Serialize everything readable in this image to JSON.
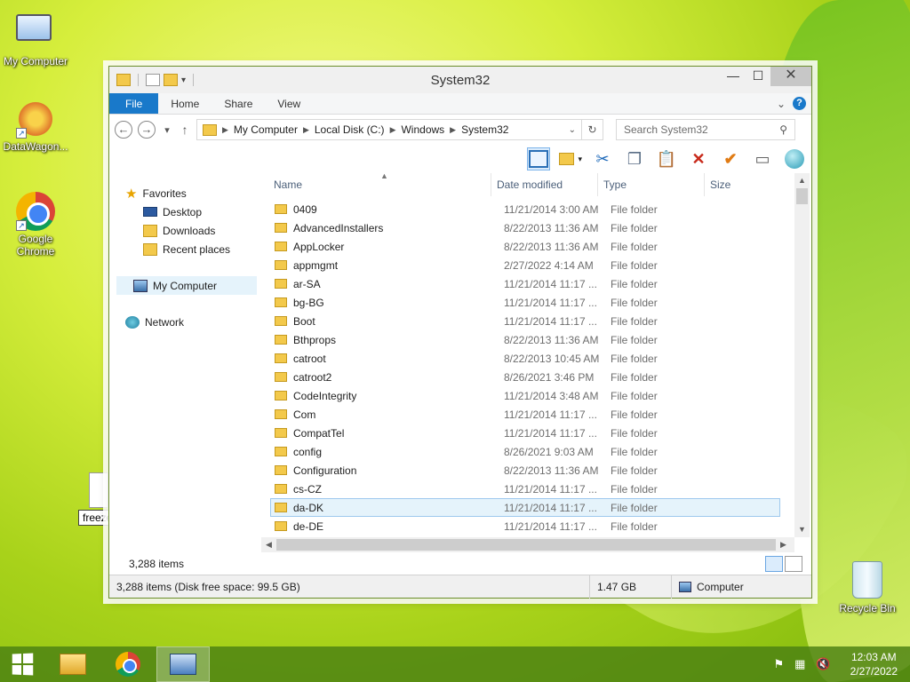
{
  "desktop": {
    "icons": [
      {
        "label": "My Computer"
      },
      {
        "label": "DataWagon..."
      },
      {
        "label": "Google Chrome"
      },
      {
        "label": "Recycle Bin"
      }
    ],
    "freeze_label": "freeze"
  },
  "window": {
    "title": "System32",
    "controls": {
      "minimize": "—",
      "maximize": "☐",
      "close": "✕"
    }
  },
  "ribbon": {
    "tabs": [
      "File",
      "Home",
      "Share",
      "View"
    ],
    "expand": "⌄",
    "help": "?"
  },
  "nav": {
    "back": "←",
    "forward": "→",
    "recent": "▾",
    "up": "↑",
    "breadcrumb": [
      "My Computer",
      "Local Disk (C:)",
      "Windows",
      "System32"
    ],
    "search_placeholder": "Search System32"
  },
  "navpane": {
    "favorites": "Favorites",
    "desktop": "Desktop",
    "downloads": "Downloads",
    "recent": "Recent places",
    "computer": "My Computer",
    "network": "Network"
  },
  "columns": {
    "name": "Name",
    "date": "Date modified",
    "type": "Type",
    "size": "Size"
  },
  "files": [
    {
      "name": "0409",
      "date": "11/21/2014 3:00 AM",
      "type": "File folder"
    },
    {
      "name": "AdvancedInstallers",
      "date": "8/22/2013 11:36 AM",
      "type": "File folder"
    },
    {
      "name": "AppLocker",
      "date": "8/22/2013 11:36 AM",
      "type": "File folder"
    },
    {
      "name": "appmgmt",
      "date": "2/27/2022 4:14 AM",
      "type": "File folder"
    },
    {
      "name": "ar-SA",
      "date": "11/21/2014 11:17 ...",
      "type": "File folder"
    },
    {
      "name": "bg-BG",
      "date": "11/21/2014 11:17 ...",
      "type": "File folder"
    },
    {
      "name": "Boot",
      "date": "11/21/2014 11:17 ...",
      "type": "File folder"
    },
    {
      "name": "Bthprops",
      "date": "8/22/2013 11:36 AM",
      "type": "File folder"
    },
    {
      "name": "catroot",
      "date": "8/22/2013 10:45 AM",
      "type": "File folder"
    },
    {
      "name": "catroot2",
      "date": "8/26/2021 3:46 PM",
      "type": "File folder"
    },
    {
      "name": "CodeIntegrity",
      "date": "11/21/2014 3:48 AM",
      "type": "File folder"
    },
    {
      "name": "Com",
      "date": "11/21/2014 11:17 ...",
      "type": "File folder"
    },
    {
      "name": "CompatTel",
      "date": "11/21/2014 11:17 ...",
      "type": "File folder"
    },
    {
      "name": "config",
      "date": "8/26/2021 9:03 AM",
      "type": "File folder"
    },
    {
      "name": "Configuration",
      "date": "8/22/2013 11:36 AM",
      "type": "File folder"
    },
    {
      "name": "cs-CZ",
      "date": "11/21/2014 11:17 ...",
      "type": "File folder"
    },
    {
      "name": "da-DK",
      "date": "11/21/2014 11:17 ...",
      "type": "File folder",
      "selected": true
    },
    {
      "name": "de-DE",
      "date": "11/21/2014 11:17 ...",
      "type": "File folder"
    }
  ],
  "status": {
    "count": "3,288 items",
    "detail": "3,288 items (Disk free space: 99.5 GB)",
    "size": "1.47 GB",
    "location": "Computer"
  },
  "taskbar": {
    "time": "12:03 AM",
    "date": "2/27/2022"
  }
}
